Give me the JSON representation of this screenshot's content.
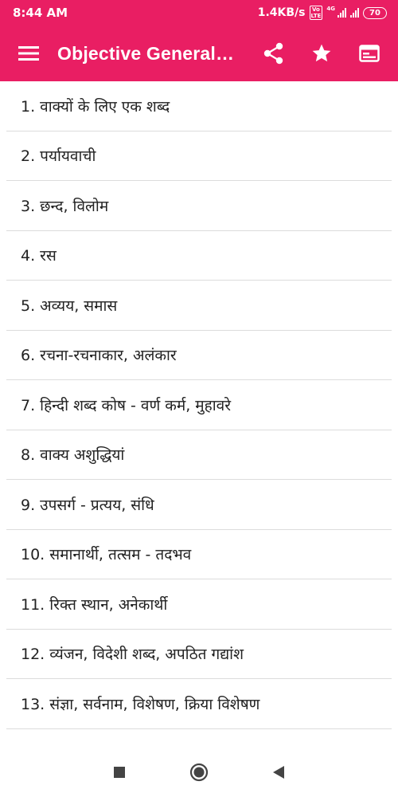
{
  "status_bar": {
    "time": "8:44 AM",
    "speed": "1.4KB/s",
    "volte_label": "Vo\nLTE",
    "network_label": "4G",
    "battery": "70"
  },
  "app_bar": {
    "title": "Objective General Hindi",
    "icons": [
      "menu-icon",
      "share-icon",
      "star-icon",
      "web-icon"
    ]
  },
  "items": [
    "1. वाक्यों के लिए एक शब्द",
    "2. पर्यायवाची",
    "3. छन्द, विलोम",
    "4. रस",
    "5. अव्यय, समास",
    "6. रचना-रचनाकार, अलंकार",
    "7. हिन्दी शब्द कोष - वर्ण कर्म, मुहावरे",
    "8. वाक्य अशुद्धियां",
    "9. उपसर्ग - प्रत्यय, संधि",
    "10. समानार्थी, तत्सम - तदभव",
    "11. रिक्त स्थान, अनेकार्थी",
    "12. व्यंजन, विदेशी शब्द, अपठित गद्यांश",
    "13. संज्ञा, सर्वनाम, विशेषण, क्रिया विशेषण"
  ],
  "colors": {
    "accent": "#e91e63",
    "text": "#222222",
    "divider": "#dcdcdc"
  }
}
